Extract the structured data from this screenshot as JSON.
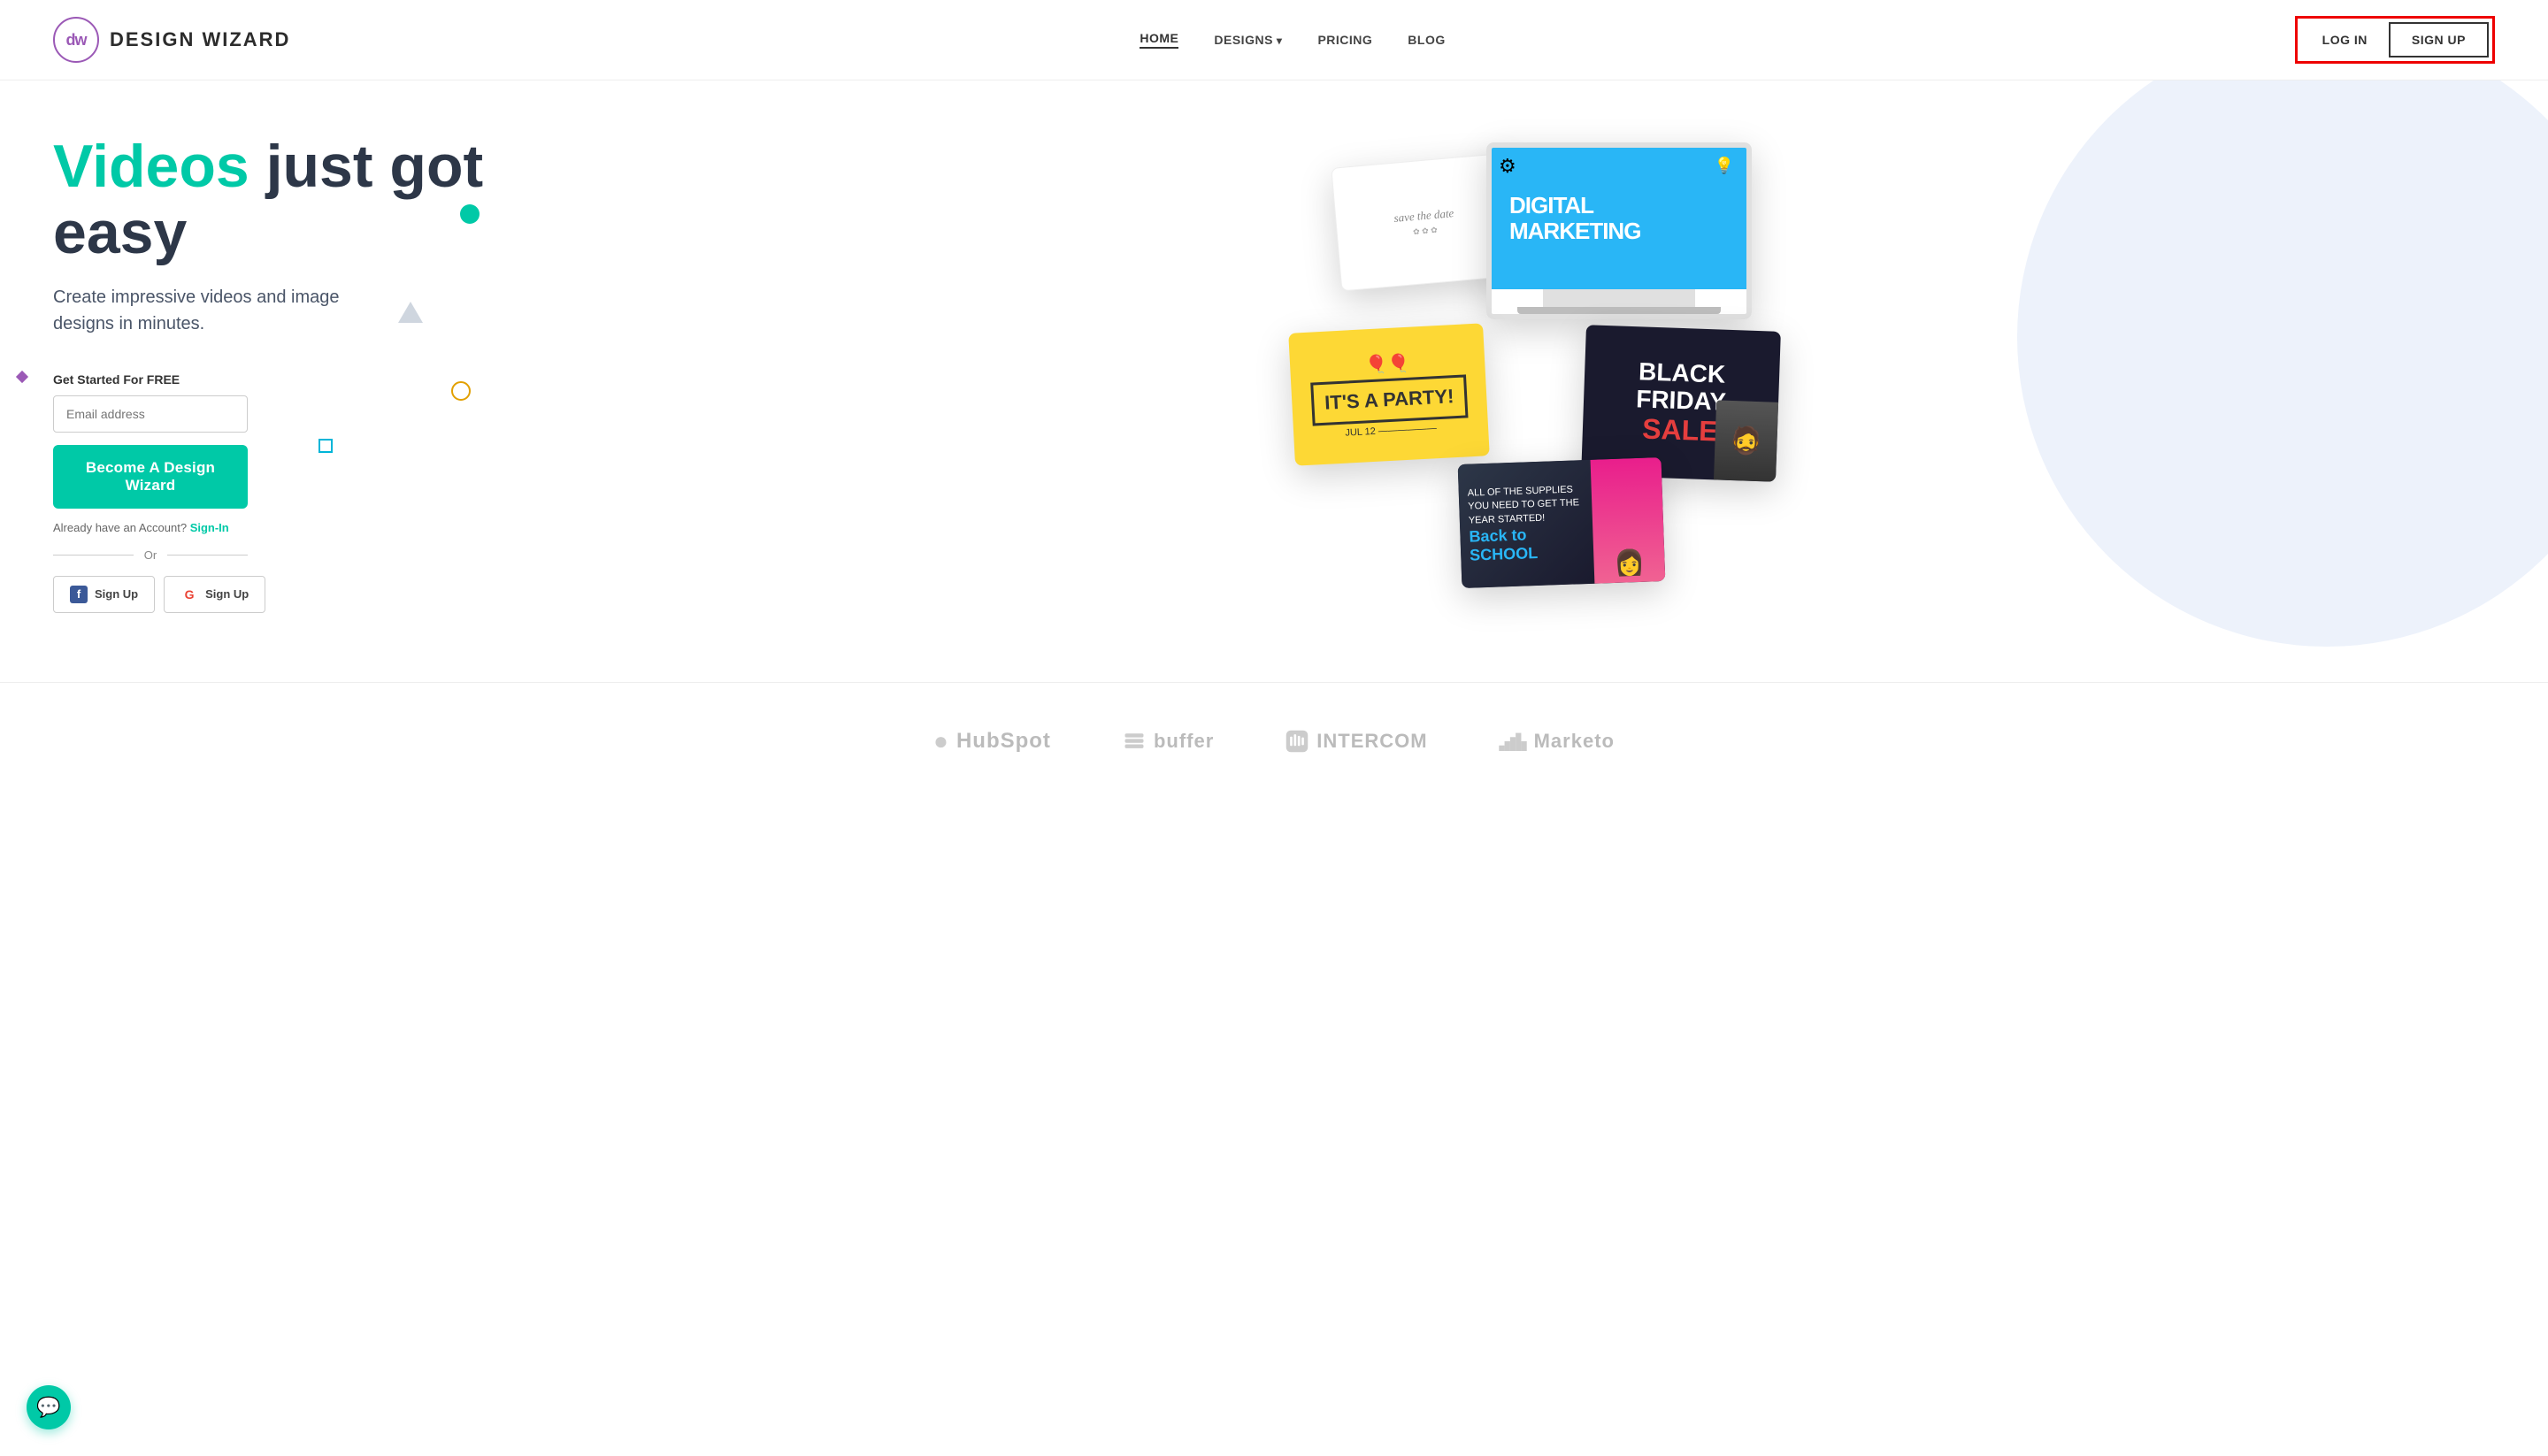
{
  "header": {
    "logo": {
      "initials": "dw",
      "name": "DESIGN WIZARD"
    },
    "nav": {
      "items": [
        {
          "label": "HOME",
          "active": true
        },
        {
          "label": "DESIGNS",
          "hasDropdown": true
        },
        {
          "label": "PRICING"
        },
        {
          "label": "BLOG"
        }
      ]
    },
    "actions": {
      "login": "LOG IN",
      "signup": "SIGN UP"
    }
  },
  "hero": {
    "headline_part1": "Videos",
    "headline_part2": " just got easy",
    "subheadline": "Create impressive videos and image designs in minutes.",
    "cta_section": {
      "label": "Get Started For FREE",
      "email_placeholder": "",
      "button_label": "Become A Design Wizard",
      "already_text": "Already have an Account?",
      "signin_text": "Sign-In",
      "or_text": "Or",
      "facebook_signup": "Sign Up",
      "google_signup": "Sign Up"
    }
  },
  "design_cards": {
    "digital_marketing": {
      "title": "DIGITAL",
      "subtitle": "MARKETING",
      "background": "#29b6f6"
    },
    "save_the_date": {
      "text": "save the date"
    },
    "party": {
      "title": "IT'S A PARTY!",
      "emoji": "🎈🎈"
    },
    "black_friday": {
      "title": "BLACK FRIDAY",
      "subtitle": "SALE"
    },
    "back_to_school": {
      "subtitle": "Back to SCHOOL",
      "body_text": "ALL OF THE SUPPLIES YOU NEED TO GET THE YEAR STARTED!"
    }
  },
  "brands": [
    {
      "name": "HubSpot",
      "icon": "hubspot"
    },
    {
      "name": "buffer",
      "icon": "buffer"
    },
    {
      "name": "INTERCOM",
      "icon": "intercom"
    },
    {
      "name": "Marketo",
      "icon": "marketo"
    }
  ],
  "chat": {
    "icon": "chat-bubble"
  }
}
